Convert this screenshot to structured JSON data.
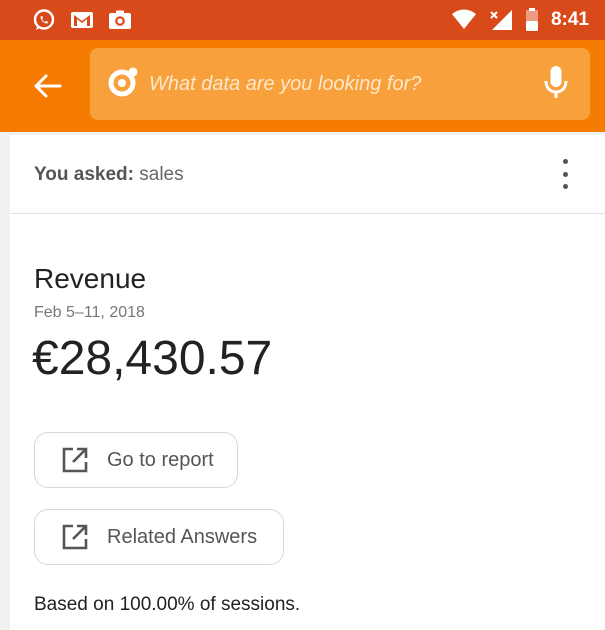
{
  "status_bar": {
    "time": "8:41",
    "left_icons": [
      "whatsapp-icon",
      "gmail-icon",
      "camera-icon"
    ],
    "right_icons": [
      "wifi-icon",
      "signal-icon",
      "battery-icon"
    ]
  },
  "app_bar": {
    "search": {
      "placeholder": "What data are you looking for?"
    }
  },
  "query": {
    "label": "You asked:",
    "value": "sales"
  },
  "result": {
    "metric": "Revenue",
    "date_range": "Feb 5–11, 2018",
    "value": "€28,430.57"
  },
  "actions": [
    {
      "label": "Go to report",
      "icon": "open-external-icon"
    },
    {
      "label": "Related Answers",
      "icon": "open-external-icon"
    }
  ],
  "note": "Based on 100.00% of sessions.",
  "colors": {
    "status_bar": "#d94a1a",
    "app_bar": "#f57c00",
    "search_box": "#f7a03c"
  }
}
